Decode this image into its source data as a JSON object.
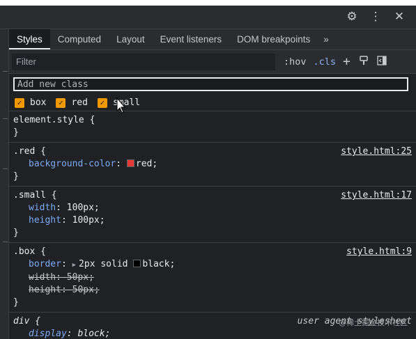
{
  "tabs": [
    "Styles",
    "Computed",
    "Layout",
    "Event listeners",
    "DOM breakpoints"
  ],
  "tabs_more": "»",
  "filter": {
    "placeholder": "Filter",
    "hov": ":hov",
    "cls": ".cls",
    "plus": "+"
  },
  "add_class": {
    "placeholder": "Add new class"
  },
  "classes": [
    {
      "name": "box",
      "checked": true
    },
    {
      "name": "red",
      "checked": true
    },
    {
      "name": "small",
      "checked": true
    }
  ],
  "rules": {
    "element_style": {
      "selector": "element.style {",
      "close": "}"
    },
    "red": {
      "selector": ".red {",
      "source": "style.html:25",
      "close": "}",
      "prop": "background-color",
      "value": "red",
      "swatch": "#e53935"
    },
    "small": {
      "selector": ".small {",
      "source": "style.html:17",
      "close": "}",
      "props": [
        {
          "name": "width",
          "value": "100px;"
        },
        {
          "name": "height",
          "value": "100px;"
        }
      ]
    },
    "box": {
      "selector": ".box {",
      "source": "style.html:9",
      "close": "}",
      "border_name": "border",
      "border_value_pre": "2px solid ",
      "border_value_post": "black;",
      "border_swatch": "#000000",
      "struck": [
        {
          "name": "width",
          "value": "50px;"
        },
        {
          "name": "height",
          "value": "50px;"
        }
      ]
    },
    "div": {
      "selector": "div {",
      "source": "user agent stylesheet",
      "prop": "display",
      "value": "block;"
    }
  },
  "watermark": "@稀土掘金技术社区"
}
